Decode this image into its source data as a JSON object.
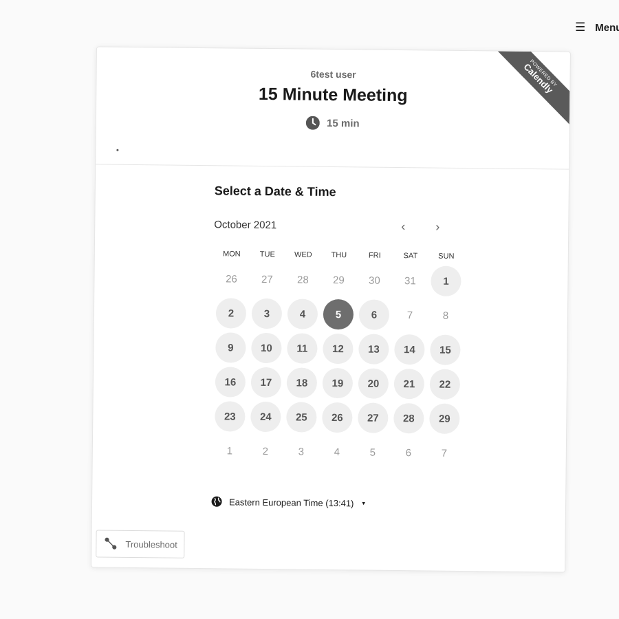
{
  "menu": {
    "icon": "hamburger-icon",
    "label": "Menu",
    "glyph": "☰"
  },
  "event": {
    "host": "6test user",
    "title": "15 Minute Meeting",
    "duration": "15 min",
    "description_dot": "."
  },
  "ribbon": {
    "powered": "POWERED BY",
    "brand": "Calendly"
  },
  "picker": {
    "heading": "Select a Date & Time",
    "month": "October 2021",
    "prev_glyph": "‹",
    "next_glyph": "›",
    "weekdays": [
      "MON",
      "TUE",
      "WED",
      "THU",
      "FRI",
      "SAT",
      "SUN"
    ],
    "days": [
      {
        "label": "26",
        "state": "disabled"
      },
      {
        "label": "27",
        "state": "disabled"
      },
      {
        "label": "28",
        "state": "disabled"
      },
      {
        "label": "29",
        "state": "disabled"
      },
      {
        "label": "30",
        "state": "disabled"
      },
      {
        "label": "31",
        "state": "disabled"
      },
      {
        "label": "1",
        "state": "available"
      },
      {
        "label": "2",
        "state": "available"
      },
      {
        "label": "3",
        "state": "available"
      },
      {
        "label": "4",
        "state": "available"
      },
      {
        "label": "5",
        "state": "selected"
      },
      {
        "label": "6",
        "state": "available"
      },
      {
        "label": "7",
        "state": "disabled"
      },
      {
        "label": "8",
        "state": "disabled"
      },
      {
        "label": "9",
        "state": "available"
      },
      {
        "label": "10",
        "state": "available"
      },
      {
        "label": "11",
        "state": "available"
      },
      {
        "label": "12",
        "state": "available"
      },
      {
        "label": "13",
        "state": "available"
      },
      {
        "label": "14",
        "state": "available"
      },
      {
        "label": "15",
        "state": "available"
      },
      {
        "label": "16",
        "state": "available"
      },
      {
        "label": "17",
        "state": "available"
      },
      {
        "label": "18",
        "state": "available"
      },
      {
        "label": "19",
        "state": "available"
      },
      {
        "label": "20",
        "state": "available"
      },
      {
        "label": "21",
        "state": "available"
      },
      {
        "label": "22",
        "state": "available"
      },
      {
        "label": "23",
        "state": "available"
      },
      {
        "label": "24",
        "state": "available"
      },
      {
        "label": "25",
        "state": "available"
      },
      {
        "label": "26",
        "state": "available"
      },
      {
        "label": "27",
        "state": "available"
      },
      {
        "label": "28",
        "state": "available"
      },
      {
        "label": "29",
        "state": "available"
      },
      {
        "label": "1",
        "state": "disabled"
      },
      {
        "label": "2",
        "state": "disabled"
      },
      {
        "label": "3",
        "state": "disabled"
      },
      {
        "label": "4",
        "state": "disabled"
      },
      {
        "label": "5",
        "state": "disabled"
      },
      {
        "label": "6",
        "state": "disabled"
      },
      {
        "label": "7",
        "state": "disabled"
      }
    ],
    "timezone": "Eastern European Time (13:41)",
    "timezone_caret": "▾"
  },
  "troubleshoot": {
    "label": "Troubleshoot"
  },
  "colors": {
    "selected": "#6e6e6e",
    "available": "#eeeeee",
    "ribbon": "#5a5a5a"
  }
}
